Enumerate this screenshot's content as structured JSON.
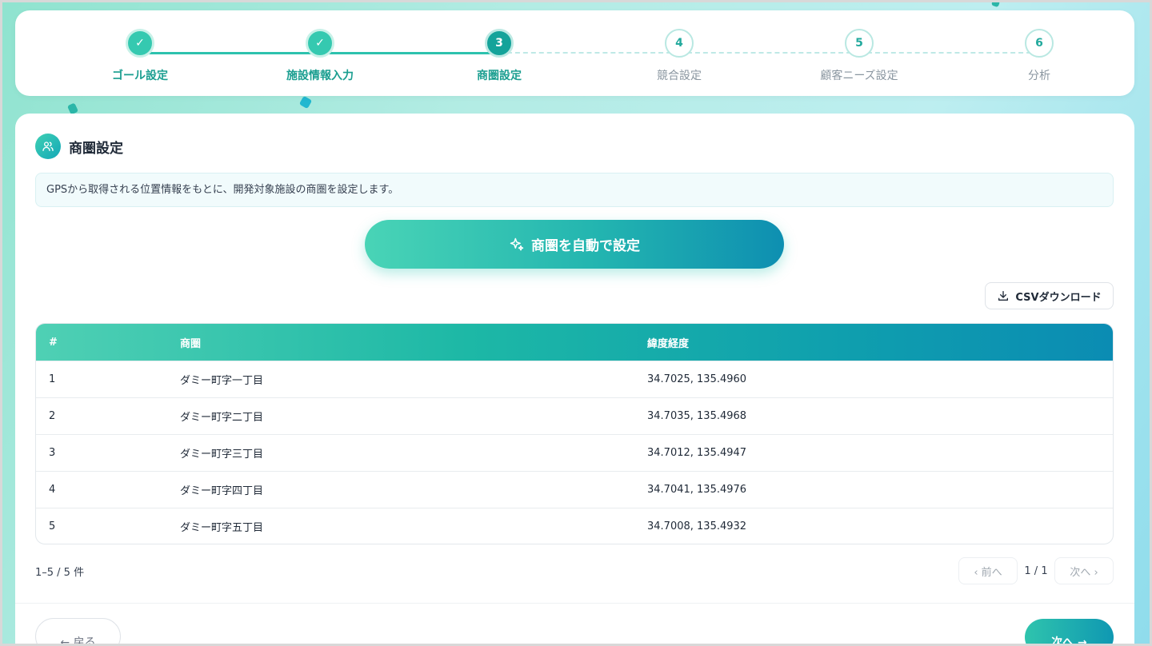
{
  "stepper": {
    "steps": [
      {
        "number": "1",
        "mark": "✓",
        "label": "ゴール設定",
        "state": "done"
      },
      {
        "number": "2",
        "mark": "✓",
        "label": "施設情報入力",
        "state": "done"
      },
      {
        "number": "3",
        "mark": "3",
        "label": "商圏設定",
        "state": "active"
      },
      {
        "number": "4",
        "mark": "4",
        "label": "競合設定",
        "state": "todo"
      },
      {
        "number": "5",
        "mark": "5",
        "label": "顧客ニーズ設定",
        "state": "todo"
      },
      {
        "number": "6",
        "mark": "6",
        "label": "分析",
        "state": "todo"
      }
    ]
  },
  "section": {
    "icon": "users-icon",
    "title": "商圏設定",
    "description": "GPSから取得される位置情報をもとに、開発対象施設の商圏を設定します。"
  },
  "actions": {
    "auto_icon": "sparkles-icon",
    "auto_label": "商圏を自動で設定",
    "csv_icon": "download-icon",
    "csv_label": "CSVダウンロード"
  },
  "table": {
    "headers": [
      "#",
      "商圏",
      "緯度経度"
    ],
    "rows": [
      [
        "1",
        "ダミー町字一丁目",
        "34.7025, 135.4960"
      ],
      [
        "2",
        "ダミー町字二丁目",
        "34.7035, 135.4968"
      ],
      [
        "3",
        "ダミー町字三丁目",
        "34.7012, 135.4947"
      ],
      [
        "4",
        "ダミー町字四丁目",
        "34.7041, 135.4976"
      ],
      [
        "5",
        "ダミー町字五丁目",
        "34.7008, 135.4932"
      ]
    ]
  },
  "pagination": {
    "count": "1–5 / 5 件",
    "prev": "‹ 前へ",
    "page": "1 / 1",
    "next": "次へ ›"
  },
  "footer": {
    "back": "← 戻る",
    "next": "次へ →"
  },
  "colors": {
    "accent": "#1db8a6",
    "accent_dark": "#0b8cb3",
    "step_label": "#1a9e90"
  }
}
